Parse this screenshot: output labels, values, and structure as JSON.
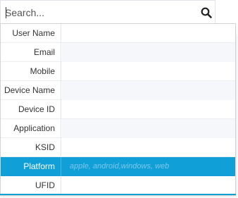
{
  "search": {
    "placeholder": "Search...",
    "value": ""
  },
  "fields": [
    {
      "label": "User Name",
      "hint": ""
    },
    {
      "label": "Email",
      "hint": ""
    },
    {
      "label": "Mobile",
      "hint": ""
    },
    {
      "label": "Device Name",
      "hint": ""
    },
    {
      "label": "Device ID",
      "hint": ""
    },
    {
      "label": "Application",
      "hint": ""
    },
    {
      "label": "KSID",
      "hint": ""
    },
    {
      "label": "Platform",
      "hint": "apple, android,windows, web"
    },
    {
      "label": "UFID",
      "hint": ""
    }
  ],
  "selected_field": "Platform",
  "colors": {
    "accent": "#109fd6",
    "selected_text": "#ffffff",
    "hint_text": "#7cc7ea"
  },
  "icons": {
    "search": "search-icon"
  }
}
